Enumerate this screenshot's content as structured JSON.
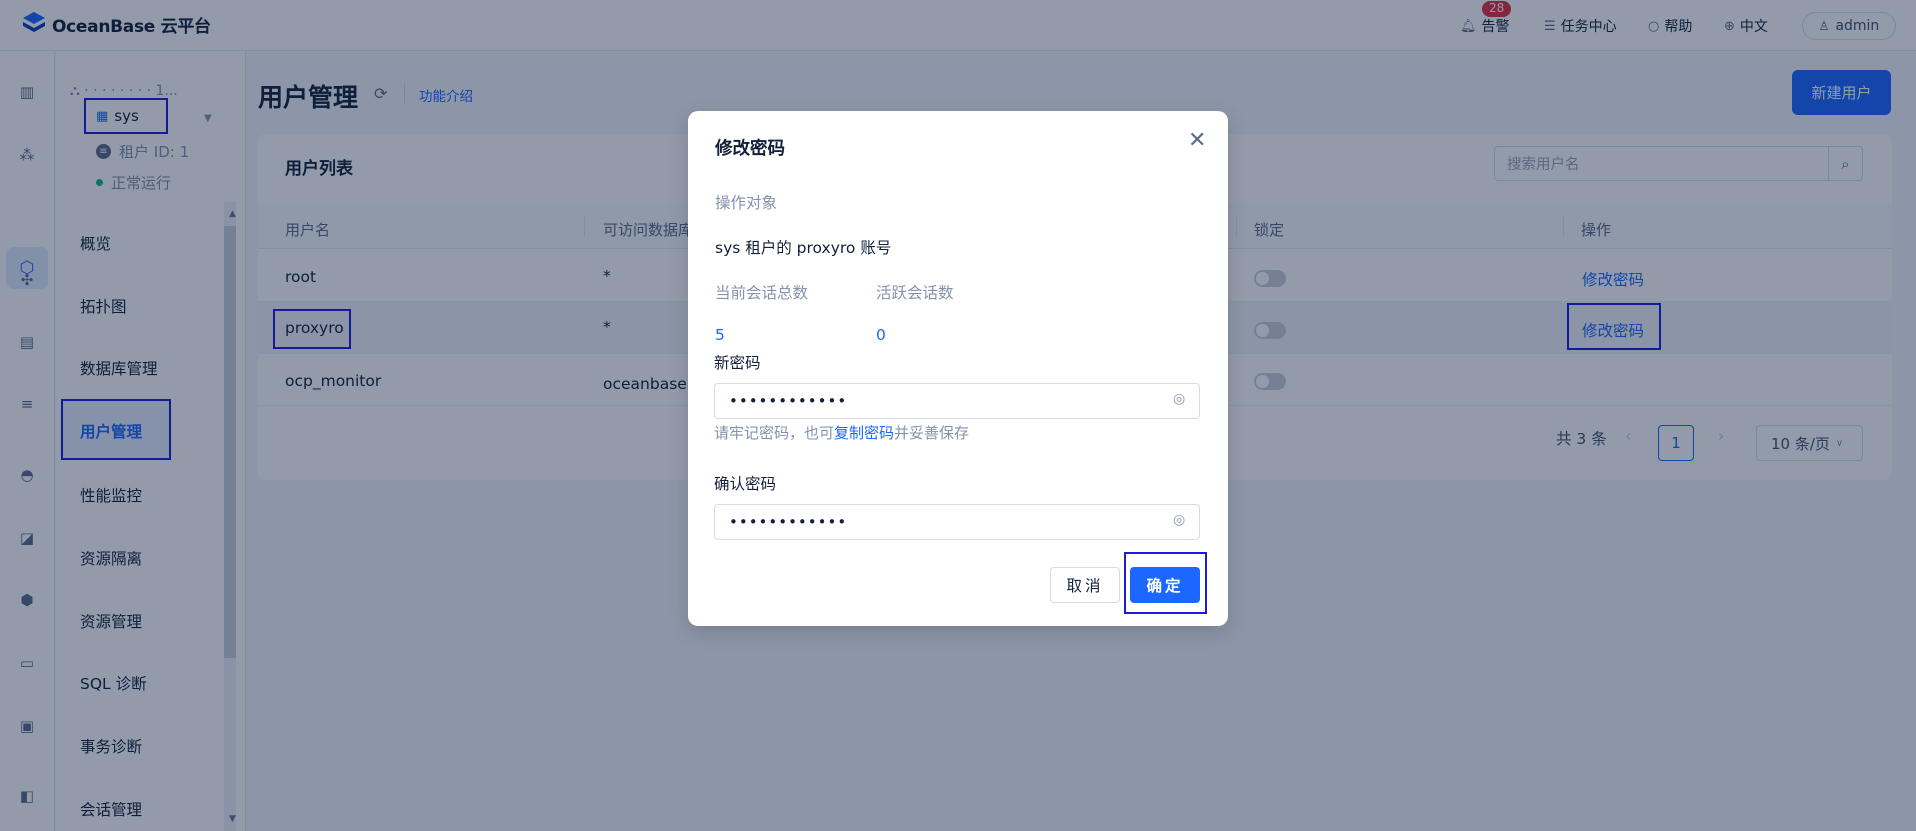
{
  "app": {
    "logo_text": "OceanBase 云平台"
  },
  "topbar": {
    "alerts_label": "告警",
    "alerts_count": "28",
    "tasks_label": "任务中心",
    "help_label": "帮助",
    "lang_label": "中文",
    "user_label": "admin"
  },
  "tenant": {
    "cluster_name": "· · · · · · · · 1...",
    "name": "sys",
    "id_text": "租户 ID: 1",
    "status_text": "正常运行"
  },
  "nav": {
    "items": [
      "概览",
      "拓扑图",
      "数据库管理",
      "用户管理",
      "性能监控",
      "资源隔离",
      "资源管理",
      "SQL 诊断",
      "事务诊断",
      "会话管理"
    ],
    "active": "用户管理"
  },
  "page": {
    "title": "用户管理",
    "intro_link": "功能介绍",
    "new_user_button": "新建用户"
  },
  "user_list": {
    "title": "用户列表",
    "search_placeholder": "搜索用户名",
    "columns": [
      "用户名",
      "可访问数据库",
      "锁定",
      "操作"
    ],
    "rows": [
      {
        "username": "root",
        "databases": "*",
        "locked": false,
        "action": "修改密码"
      },
      {
        "username": "proxyro",
        "databases": "*",
        "locked": false,
        "action": "修改密码"
      },
      {
        "username": "ocp_monitor",
        "databases": "oceanbase、",
        "locked": false,
        "action": ""
      }
    ],
    "pagination": {
      "total_text": "共 3 条",
      "current_page": "1",
      "page_size": "10 条/页"
    }
  },
  "modal": {
    "title": "修改密码",
    "target_label": "操作对象",
    "target_value": "sys 租户的 proxyro 账号",
    "sessions_total_label": "当前会话总数",
    "sessions_active_label": "活跃会话数",
    "sessions_total_value": "5",
    "sessions_active_value": "0",
    "new_password_label": "新密码",
    "new_password_value": "••••••••••••",
    "hint_prefix": "请牢记密码，也可",
    "hint_link": "复制密码",
    "hint_suffix": "并妥善保存",
    "confirm_password_label": "确认密码",
    "confirm_password_value": "••••••••••••",
    "cancel_button": "取消",
    "ok_button": "确定"
  }
}
